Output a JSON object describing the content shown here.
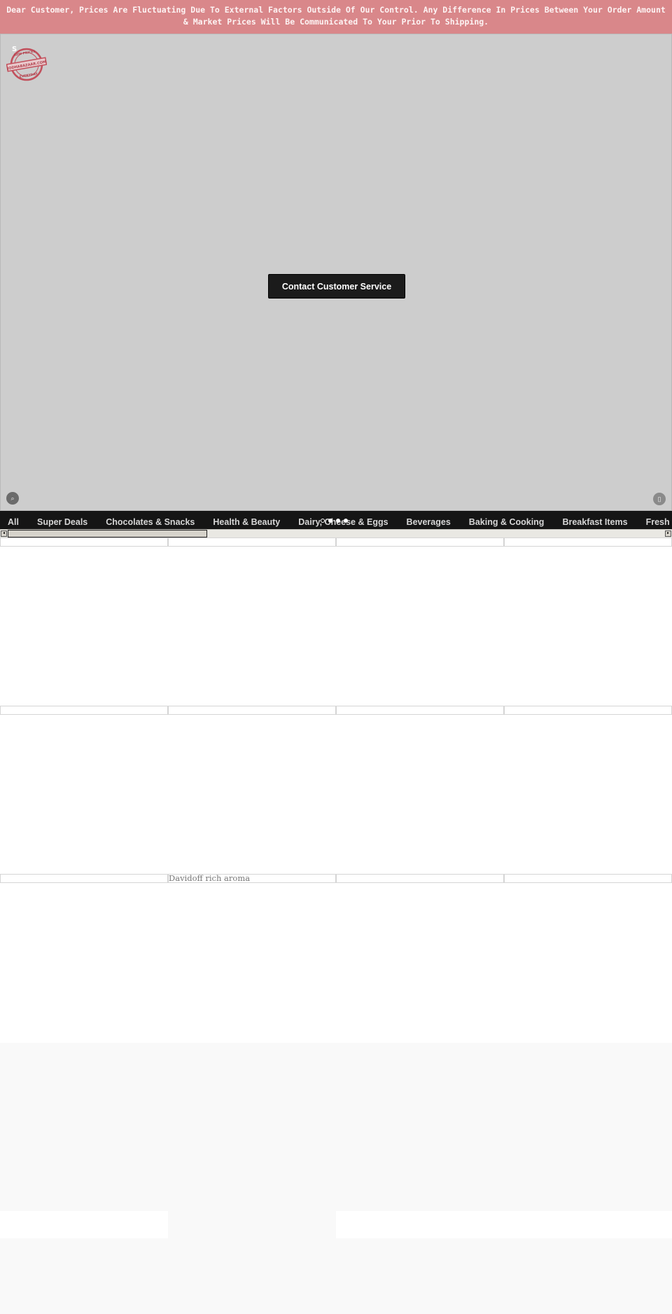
{
  "banner": {
    "line1": "Dear Customer, Prices Are Fluctuating Due To External Factors Outside Of Our Control. Any Difference In Prices Between Your Order Amount",
    "line2": "& Market Prices Will Be Communicated To Your Prior To Shipping."
  },
  "hero": {
    "logo": {
      "icon": "low-prices-stamp-icon",
      "top_text": "LOW PRICES",
      "brand_text": "JODHABAZAAR.COM",
      "bottom_text": "EVERYDAY",
      "corner_glyph": "S"
    },
    "cta_label": "Contact Customer Service",
    "left_button_icon": "chat-icon",
    "right_button_icon": "phone-icon",
    "left_button_glyph": "⌕",
    "right_button_glyph": "▯",
    "slider_dots": 4,
    "active_dot": 0
  },
  "categories": [
    "All",
    "Super Deals",
    "Chocolates & Snacks",
    "Health & Beauty",
    "Dairy, Cheese & Eggs",
    "Beverages",
    "Baking & Cooking",
    "Breakfast Items",
    "Fresh Produce"
  ],
  "scrollbar": {
    "left_arrow": "◂",
    "right_arrow": "▸"
  },
  "products": [
    [
      "",
      "",
      "",
      ""
    ],
    [
      "",
      "",
      "",
      ""
    ],
    [
      "",
      "Davidoff rich aroma",
      "",
      ""
    ]
  ],
  "colors": {
    "banner_bg": "#d9878a",
    "hero_bg": "#cdcdcd",
    "nav_bg": "#151515",
    "cta_bg": "#1b1b1b",
    "footer_bg": "#f9f9f9"
  }
}
